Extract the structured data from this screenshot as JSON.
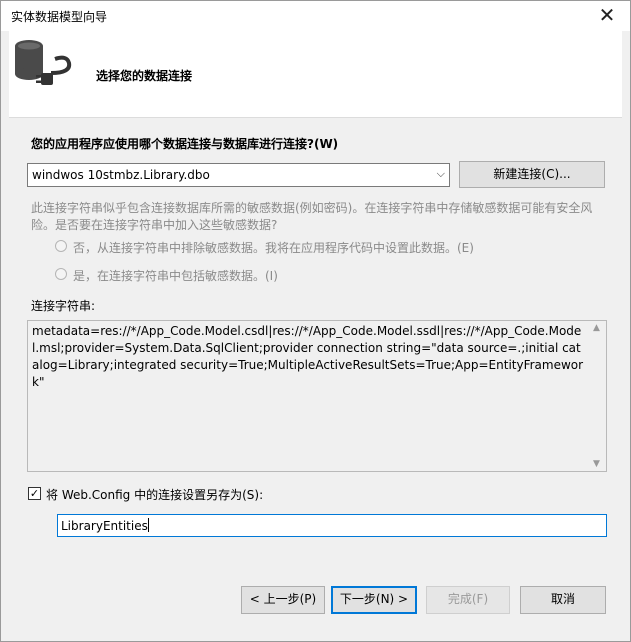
{
  "window": {
    "title": "实体数据模型向导",
    "close_glyph": "✕"
  },
  "header": {
    "icon": "database-plug-icon",
    "title": "选择您的数据连接"
  },
  "connection": {
    "question": "您的应用程序应使用哪个数据连接与数据库进行连接?(W)",
    "selected": "windwos 10stmbz.Library.dbo",
    "new_connection_label": "新建连接(C)...",
    "sensitive_warning": "此连接字符串似乎包含连接数据库所需的敏感数据(例如密码)。在连接字符串中存储敏感数据可能有安全风险。是否要在连接字符串中加入这些敏感数据?",
    "radio_exclude": "否，从连接字符串中排除敏感数据。我将在应用程序代码中设置此数据。(E)",
    "radio_include": "是，在连接字符串中包括敏感数据。(I)"
  },
  "connection_string": {
    "label": "连接字符串:",
    "value": "metadata=res://*/App_Code.Model.csdl|res://*/App_Code.Model.ssdl|res://*/App_Code.Model.msl;provider=System.Data.SqlClient;provider connection string=\"data source=.;initial catalog=Library;integrated security=True;MultipleActiveResultSets=True;App=EntityFramework\""
  },
  "save": {
    "checked": true,
    "label": "将 Web.Config 中的连接设置另存为(S):",
    "entity_name": "LibraryEntities"
  },
  "buttons": {
    "back": "< 上一步(P)",
    "next": "下一步(N) >",
    "finish": "完成(F)",
    "cancel": "取消"
  }
}
